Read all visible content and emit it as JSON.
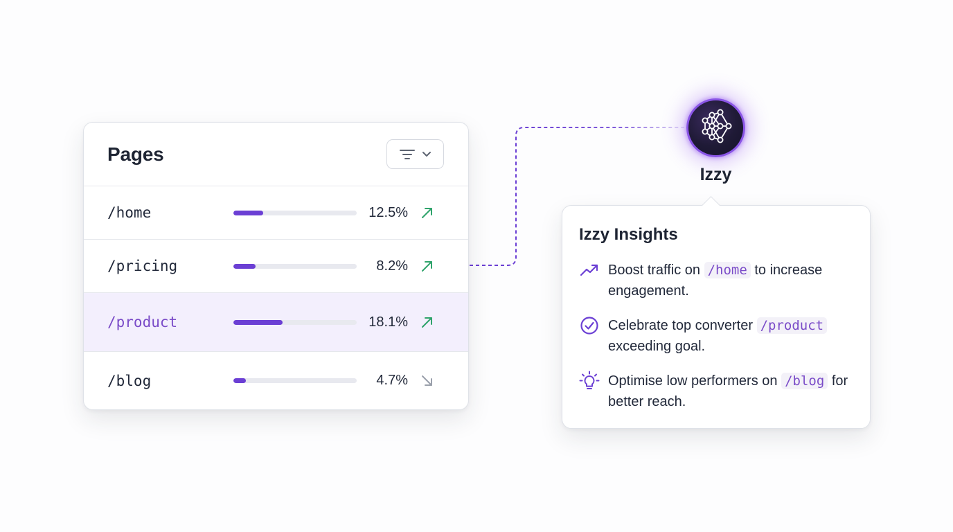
{
  "pages_panel": {
    "title": "Pages",
    "filter_icon": "filter-icon",
    "dropdown_icon": "chevron-down-icon",
    "rows": [
      {
        "path": "/home",
        "percent": "12.5%",
        "bar_fraction": 0.24,
        "trend": "up",
        "trend_icon": "arrow-up-right-icon",
        "highlighted": false
      },
      {
        "path": "/pricing",
        "percent": "8.2%",
        "bar_fraction": 0.18,
        "trend": "up",
        "trend_icon": "arrow-up-right-icon",
        "highlighted": false
      },
      {
        "path": "/product",
        "percent": "18.1%",
        "bar_fraction": 0.4,
        "trend": "up",
        "trend_icon": "arrow-up-right-icon",
        "highlighted": true
      },
      {
        "path": "/blog",
        "percent": "4.7%",
        "bar_fraction": 0.1,
        "trend": "down",
        "trend_icon": "arrow-down-right-icon",
        "highlighted": false
      }
    ]
  },
  "assistant": {
    "name": "Izzy",
    "avatar_icon": "neural-network-icon"
  },
  "insights": {
    "title": "Izzy Insights",
    "items": [
      {
        "icon": "trending-up-icon",
        "before": "Boost traffic on ",
        "code": "/home",
        "after": " to increase engagement."
      },
      {
        "icon": "check-circle-icon",
        "before": "Celebrate top converter ",
        "code": "/product",
        "after": " exceeding goal."
      },
      {
        "icon": "lightbulb-icon",
        "before": "Optimise low performers on ",
        "code": "/blog",
        "after": " for better reach."
      }
    ]
  },
  "colors": {
    "accent": "#6b3fd4",
    "trend_up": "#2fa36b",
    "trend_down": "#9aa0ab",
    "highlight_row": "#f3effd",
    "code_text": "#7a4bc8"
  }
}
